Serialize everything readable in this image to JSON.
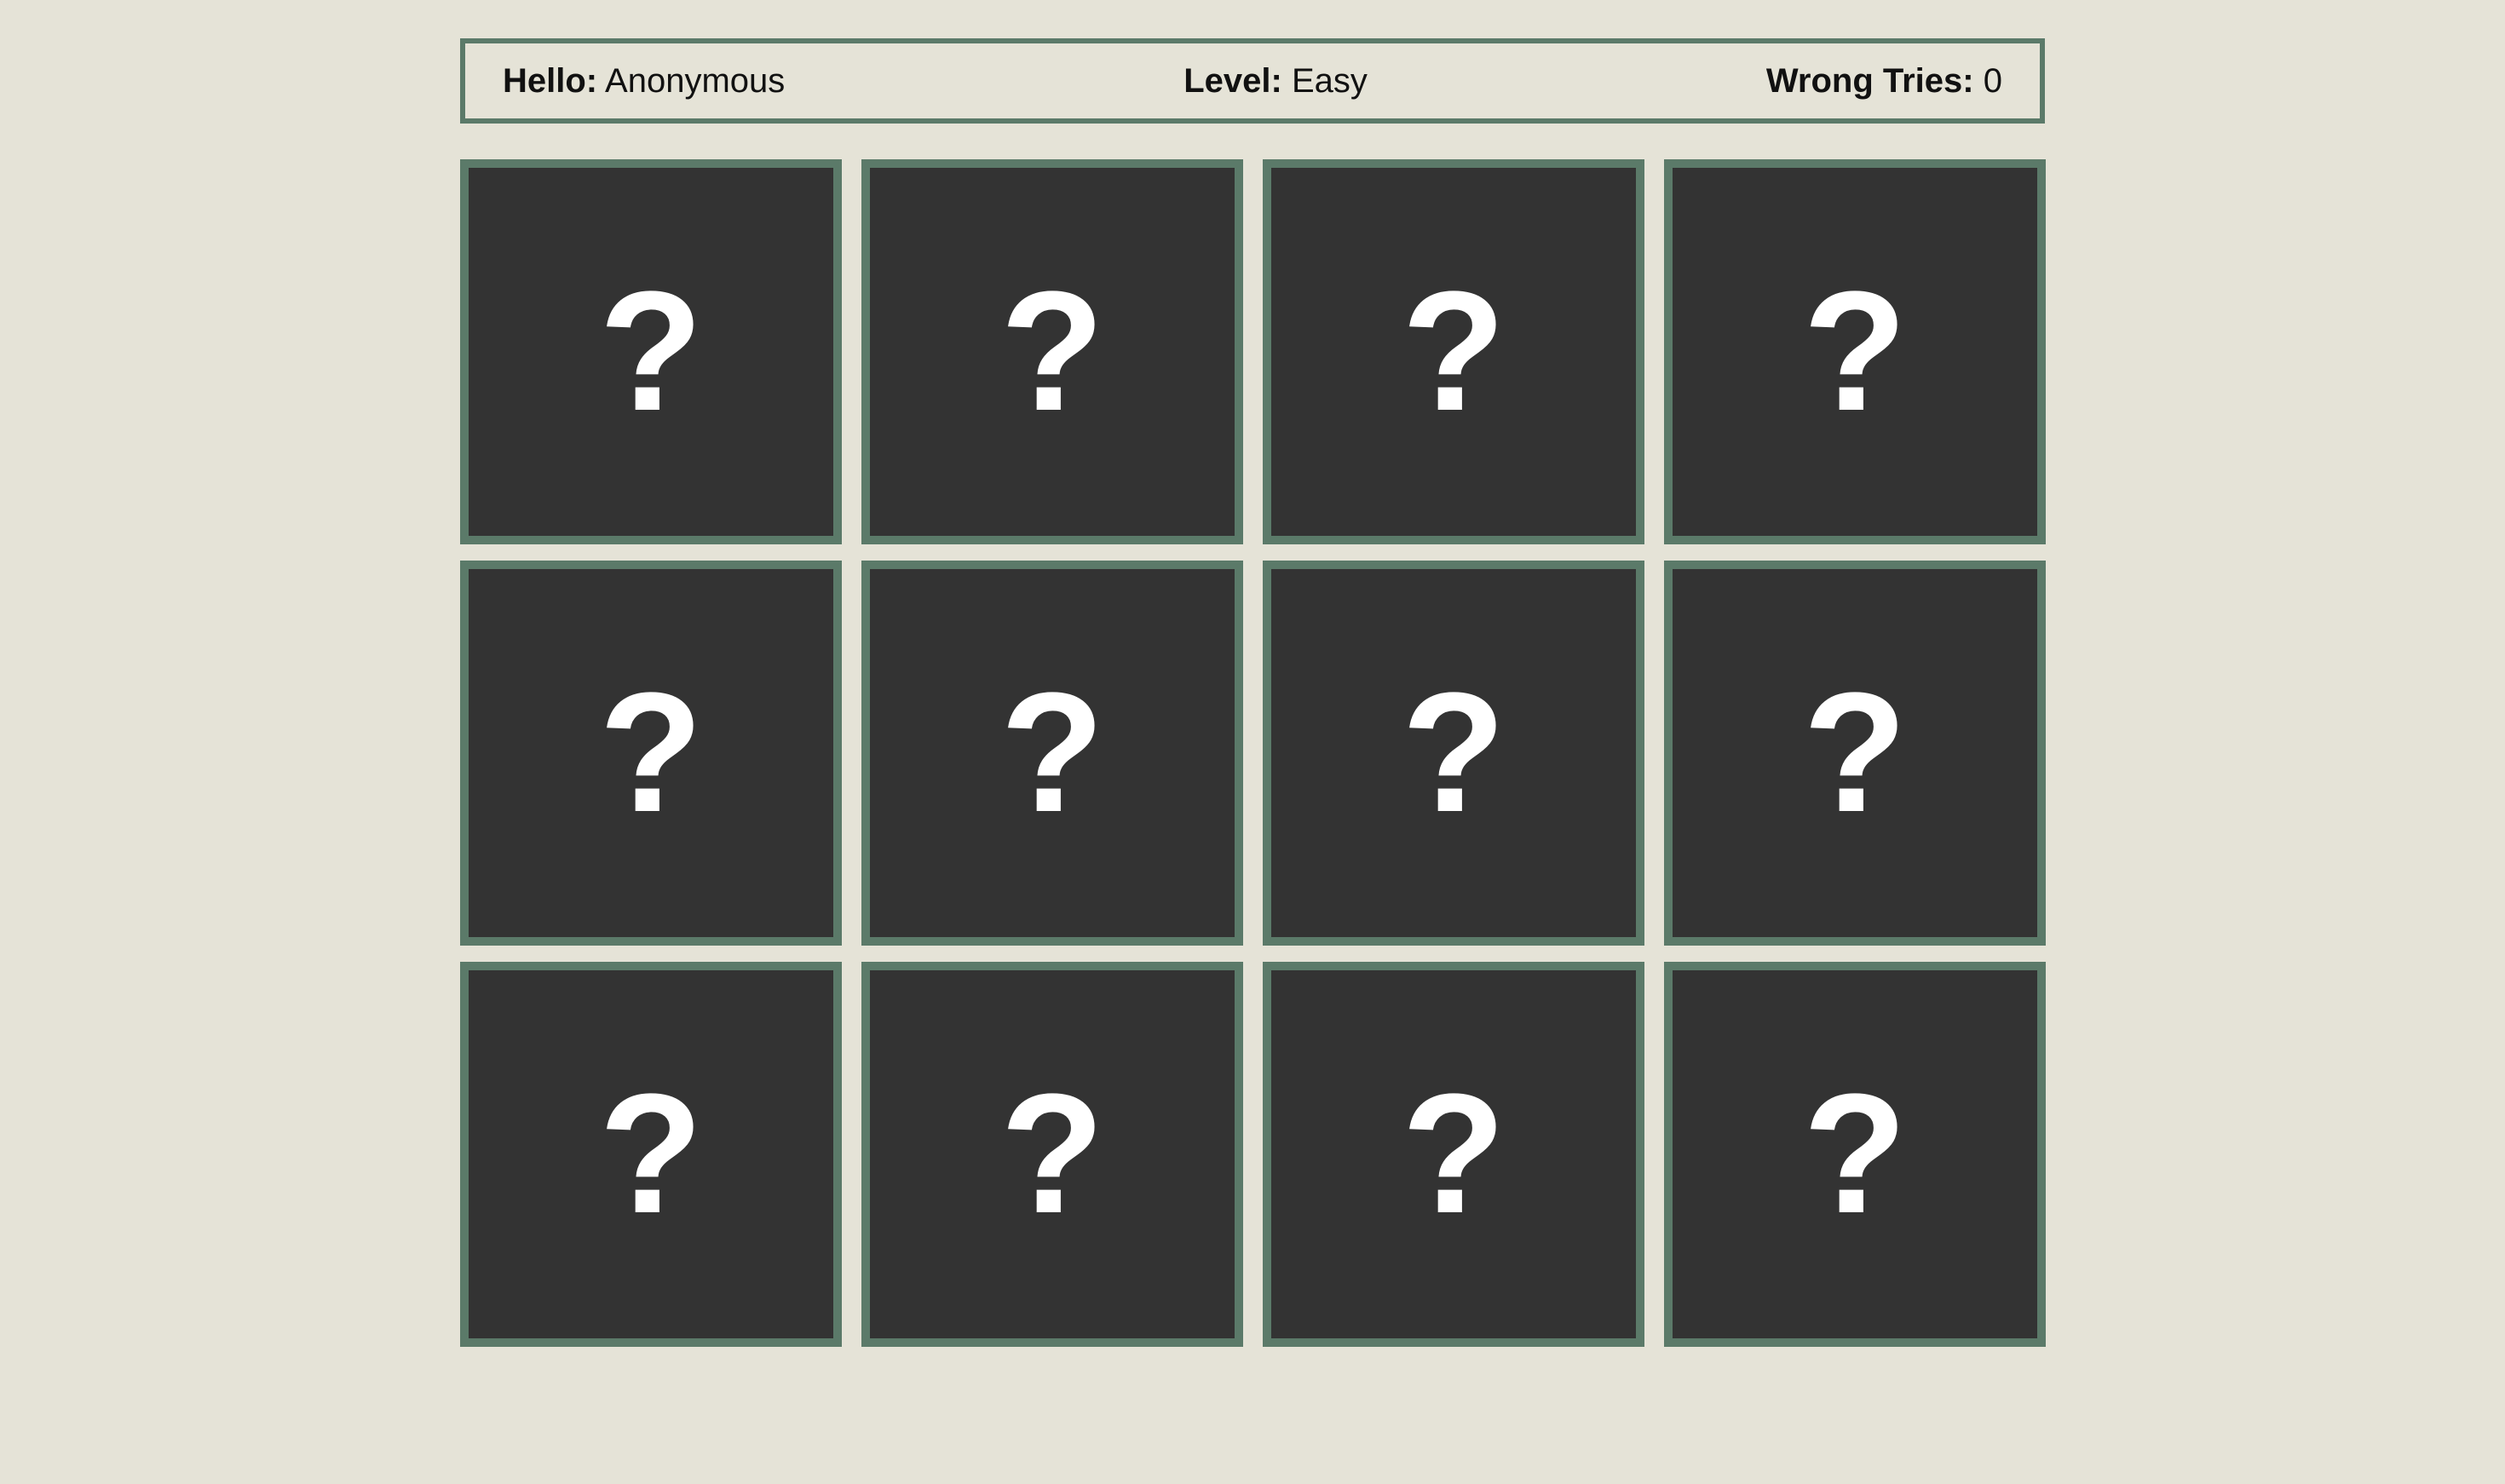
{
  "status": {
    "hello_label": "Hello:",
    "hello_value": "Anonymous",
    "level_label": "Level:",
    "level_value": "Easy",
    "wrong_label": "Wrong Tries:",
    "wrong_value": "0"
  },
  "board": {
    "columns": 4,
    "rows": 3,
    "cards": [
      {
        "face": "?"
      },
      {
        "face": "?"
      },
      {
        "face": "?"
      },
      {
        "face": "?"
      },
      {
        "face": "?"
      },
      {
        "face": "?"
      },
      {
        "face": "?"
      },
      {
        "face": "?"
      },
      {
        "face": "?"
      },
      {
        "face": "?"
      },
      {
        "face": "?"
      },
      {
        "face": "?"
      }
    ]
  },
  "colors": {
    "background": "#e5e3d7",
    "card_back": "#333333",
    "card_border": "#5b7a69",
    "glyph": "#ffffff"
  }
}
